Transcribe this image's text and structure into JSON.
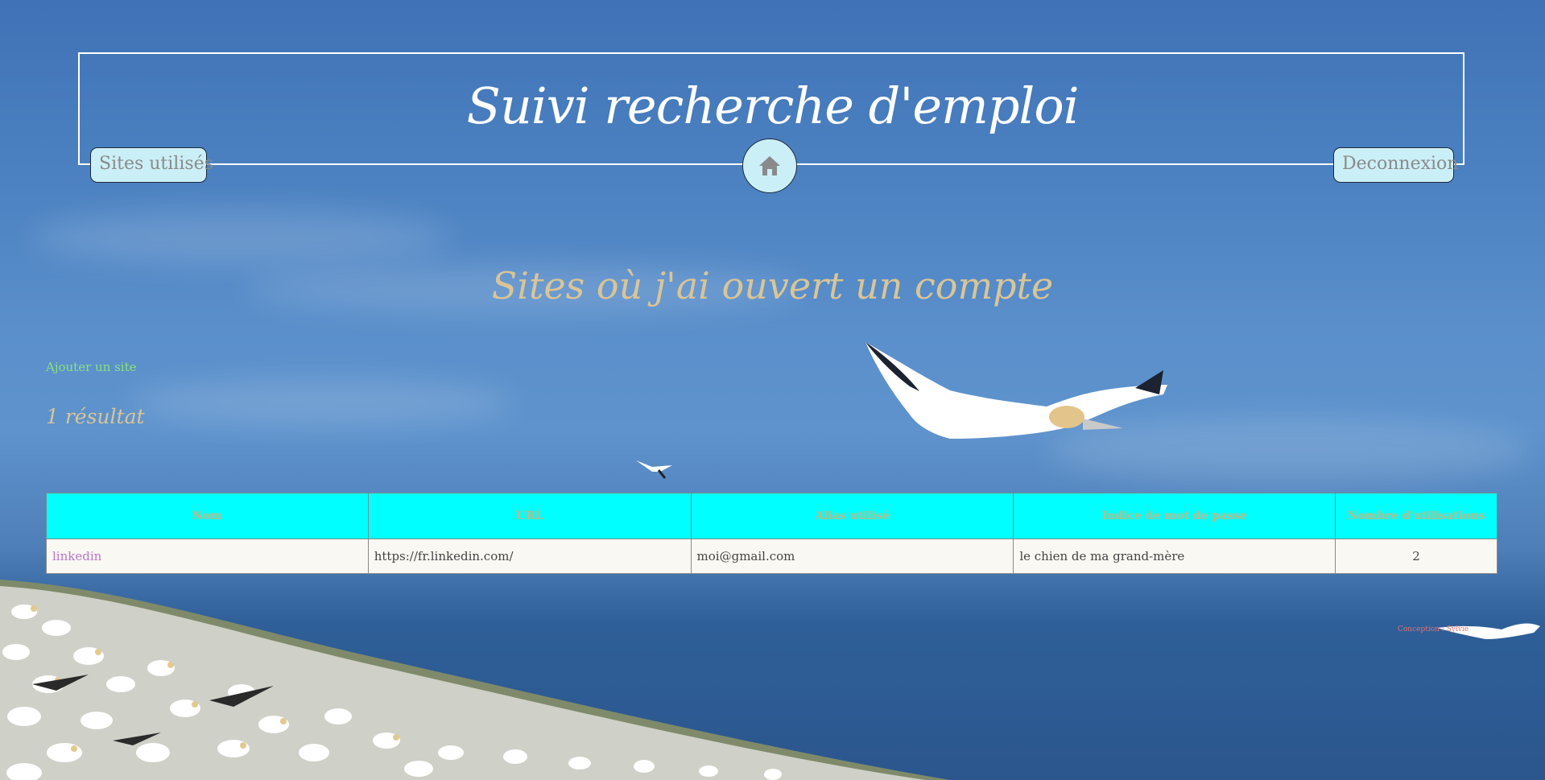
{
  "header": {
    "title": "Suivi recherche d'emploi",
    "nav_sites_label": "Sites utilisés",
    "nav_logout_label": "Deconnexion",
    "home_icon": "home-icon"
  },
  "page": {
    "heading": "Sites où j'ai ouvert un compte",
    "add_site_label": "Ajouter un site",
    "result_count": "1 résultat"
  },
  "table": {
    "columns": [
      "Nom",
      "URL",
      "Alias utilisé",
      "Indice de mot de passe",
      "Nombre d'utilisations"
    ],
    "rows": [
      {
        "nom": "linkedin",
        "url": "https://fr.linkedin.com/",
        "alias": "moi@gmail.com",
        "indice": "le chien de ma grand-mère",
        "utilisations": "2"
      }
    ]
  },
  "footer": {
    "credit": "Conception : Sylvie"
  },
  "colors": {
    "table_header_bg": "#00ffff",
    "nav_button_bg": "#cbeff6",
    "heading_text": "#d9c596",
    "add_link": "#8be07a",
    "name_link": "#b777c8"
  }
}
